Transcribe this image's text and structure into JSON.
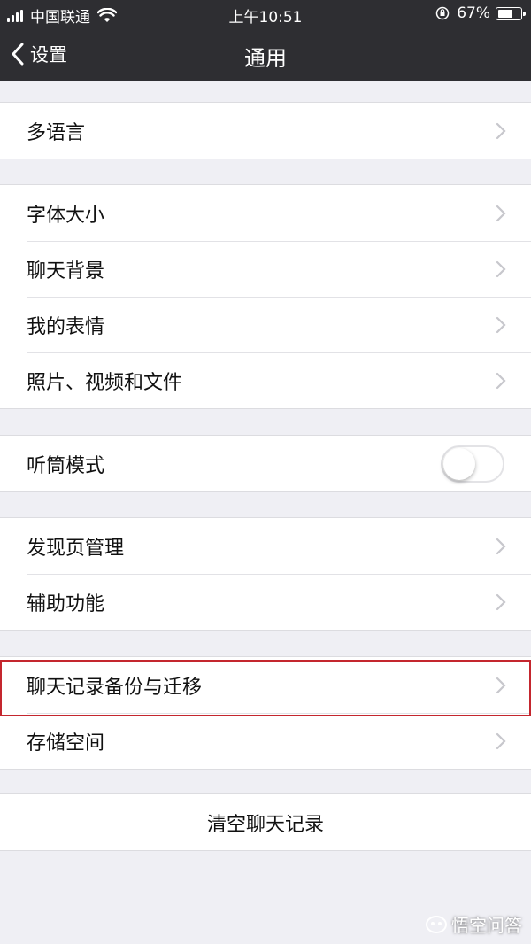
{
  "status_bar": {
    "carrier": "中国联通",
    "time": "上午10:51",
    "battery_percent": "67%",
    "battery_level": 0.67
  },
  "nav": {
    "back_label": "设置",
    "title": "通用"
  },
  "groups": {
    "g1": [
      "多语言"
    ],
    "g2": [
      "字体大小",
      "聊天背景",
      "我的表情",
      "照片、视频和文件"
    ],
    "g3": {
      "label": "听筒模式",
      "toggle_on": false
    },
    "g4": [
      "发现页管理",
      "辅助功能"
    ],
    "g5": [
      "聊天记录备份与迁移",
      "存储空间"
    ],
    "g6": {
      "label": "清空聊天记录"
    }
  },
  "highlight_color": "#c4262e",
  "watermark": "悟空问答"
}
